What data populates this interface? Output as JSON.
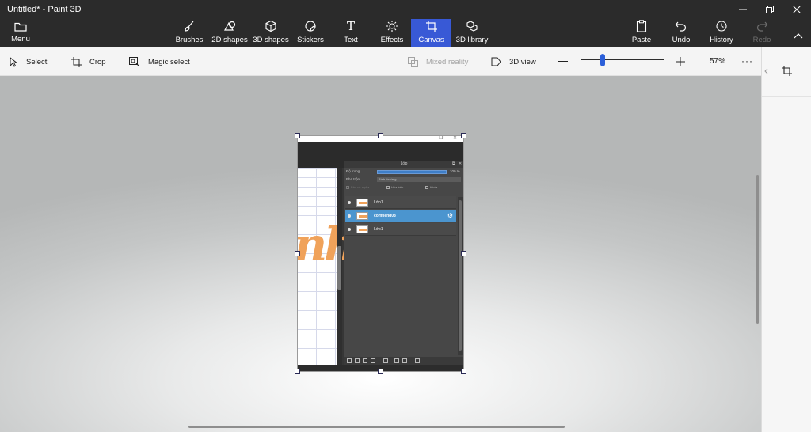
{
  "window": {
    "title": "Untitled* - Paint 3D",
    "minimize_label": "—",
    "restore_label": "❐",
    "close_label": "✕"
  },
  "menu": {
    "label": "Menu"
  },
  "tools": [
    {
      "label": "Brushes"
    },
    {
      "label": "2D shapes"
    },
    {
      "label": "3D shapes"
    },
    {
      "label": "Stickers"
    },
    {
      "label": "Text"
    },
    {
      "label": "Effects"
    },
    {
      "label": "Canvas"
    },
    {
      "label": "3D library"
    }
  ],
  "actions": {
    "paste": "Paste",
    "undo": "Undo",
    "history": "History",
    "redo": "Redo"
  },
  "subtoolbar": {
    "select": "Select",
    "crop": "Crop",
    "magic_select": "Magic select",
    "mixed_reality": "Mixed reality",
    "view_3d": "3D view",
    "zoom_percent": "57%",
    "more": "···"
  },
  "accent_color": "#3859d6",
  "canvas_content": {
    "window_controls": {
      "min": "—",
      "max": "❐",
      "close": "✕"
    },
    "lettering": "nh",
    "panel": {
      "title": "Lớp",
      "opacity_label": "Độ trong",
      "opacity_value": "100 %",
      "blend_label": "Pha trộn",
      "blend_value": "Bình thường",
      "check_lock": "Bảo vệ alpha",
      "check_clip": "Hòa trên",
      "check_lock2": "Khóa",
      "layers": [
        {
          "name": "Lớp1",
          "selected": false
        },
        {
          "name": "comtiend08",
          "selected": true
        },
        {
          "name": "Lớp1",
          "selected": false
        }
      ]
    }
  }
}
